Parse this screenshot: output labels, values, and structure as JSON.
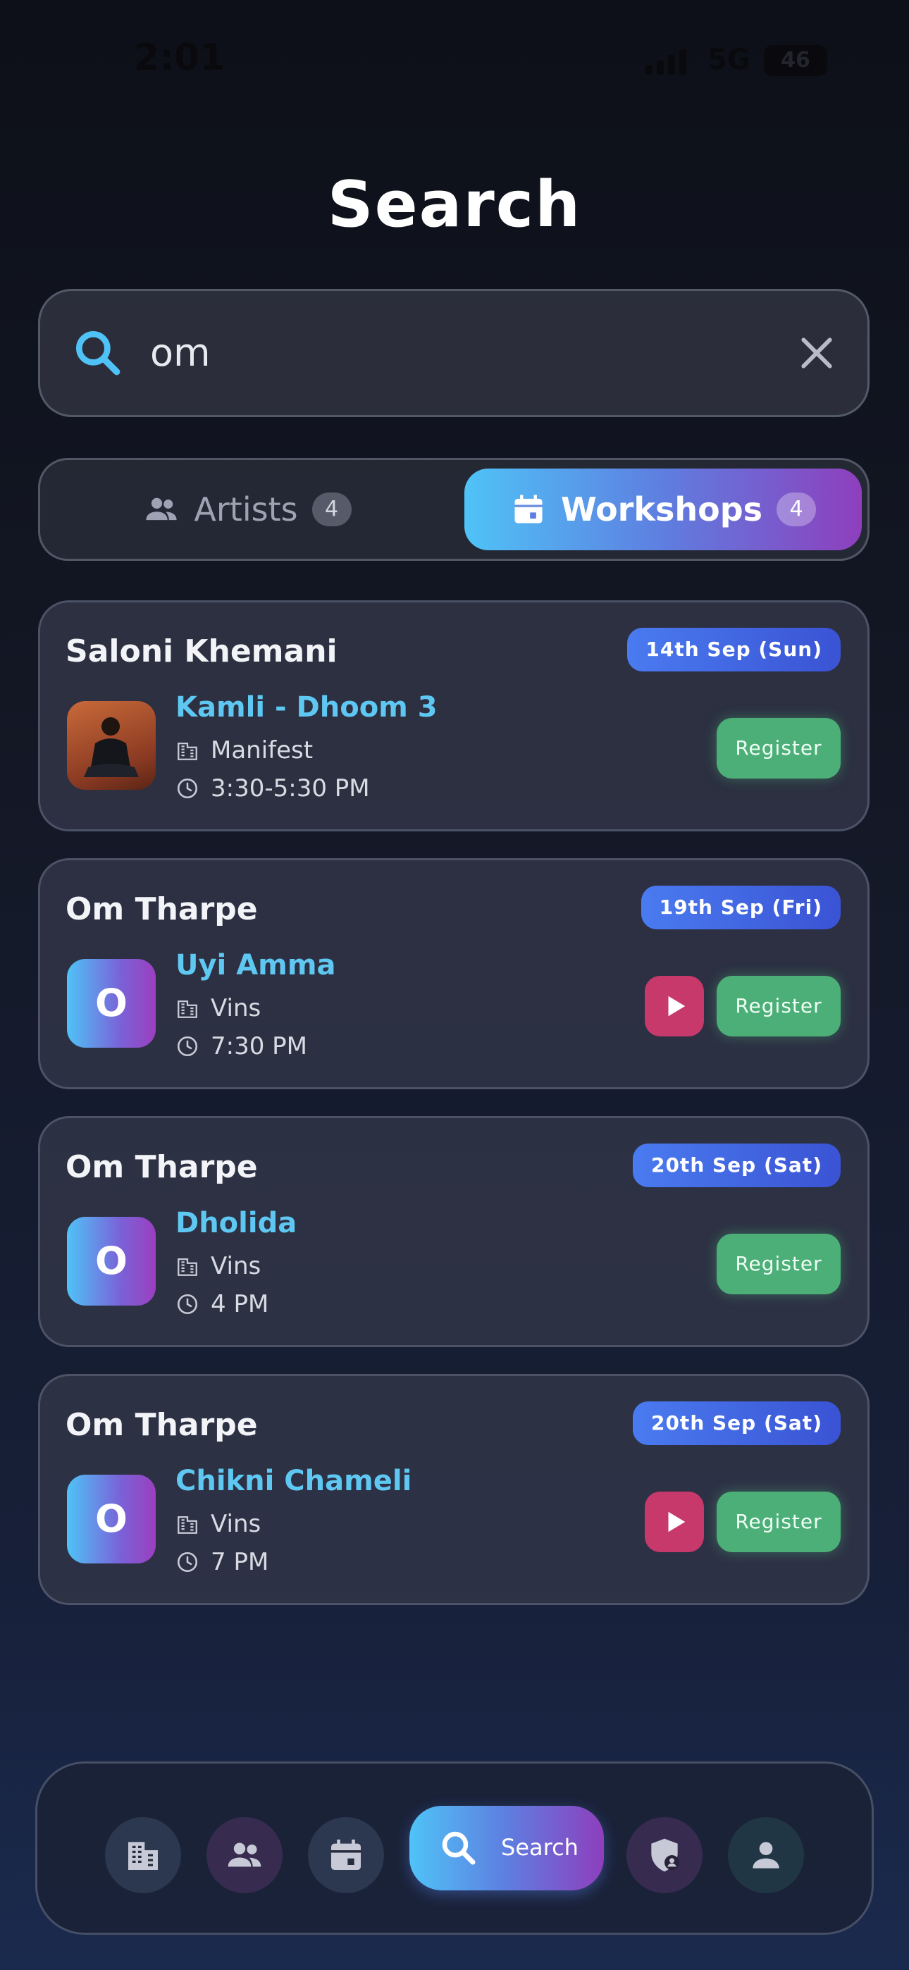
{
  "status_bar": {
    "time": "2:01",
    "network": "5G",
    "battery": "46"
  },
  "page_title": "Search",
  "search": {
    "query": "om"
  },
  "tabs": [
    {
      "label": "Artists",
      "count": "4",
      "icon": "people-icon",
      "active": false
    },
    {
      "label": "Workshops",
      "count": "4",
      "icon": "calendar-icon",
      "active": true
    }
  ],
  "workshops": [
    {
      "artist": "Saloni Khemani",
      "date": "14th Sep (Sun)",
      "title": "Kamli - Dhoom 3",
      "venue": "Manifest",
      "time": "3:30-5:30 PM",
      "thumb": "photo",
      "has_video": false,
      "register_label": "Register"
    },
    {
      "artist": "Om Tharpe",
      "date": "19th Sep (Fri)",
      "title": "Uyi Amma",
      "venue": "Vins",
      "time": "7:30 PM",
      "thumb": "O",
      "has_video": true,
      "register_label": "Register"
    },
    {
      "artist": "Om Tharpe",
      "date": "20th Sep (Sat)",
      "title": "Dholida",
      "venue": "Vins",
      "time": "4 PM",
      "thumb": "O",
      "has_video": false,
      "register_label": "Register"
    },
    {
      "artist": "Om Tharpe",
      "date": "20th Sep (Sat)",
      "title": "Chikni Chameli",
      "venue": "Vins",
      "time": "7 PM",
      "thumb": "O",
      "has_video": true,
      "register_label": "Register"
    }
  ],
  "bottom_nav": {
    "items": [
      {
        "icon": "building-icon",
        "color": "#c7cad6"
      },
      {
        "icon": "people-icon",
        "color": "#c7cad6"
      },
      {
        "icon": "calendar-icon",
        "color": "#c7cad6"
      },
      {
        "icon": "search-icon",
        "label": "Search",
        "active": true
      },
      {
        "icon": "shield-user-icon",
        "color": "#c7cad6"
      },
      {
        "icon": "person-icon",
        "color": "#c7cad6"
      }
    ]
  },
  "colors": {
    "accent_cyan": "#4fc3f7",
    "accent_purple": "#8e3fbd",
    "register_green": "#4caf78",
    "play_pink": "#c7386b",
    "title_blue": "#5fc8f2",
    "date_blue": "#4a7bf0"
  }
}
